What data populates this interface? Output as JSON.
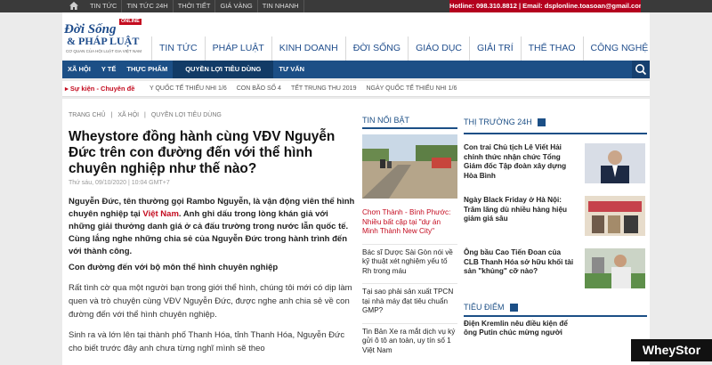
{
  "topbar": {
    "nav": [
      "TIN TỨC",
      "TIN TỨC 24H",
      "THỜI TIẾT",
      "GIÁ VÀNG",
      "TIN NHANH"
    ],
    "hotline": "Hotline: 098.310.8812 | Email: dsplonline.toasoan@gmail.com"
  },
  "logo": {
    "badge": "ONLINE",
    "line1": "Đời Sống",
    "line2": "& PHÁP LUẬT",
    "tagline": "CƠ QUAN CỦA HỘI LUẬT GIA VIỆT NAM"
  },
  "main_nav": [
    "TIN TỨC",
    "PHÁP LUẬT",
    "KINH DOANH",
    "ĐỜI SỐNG",
    "GIÁO DỤC",
    "GIẢI TRÍ",
    "THỂ THAO",
    "CÔNG NGHỆ"
  ],
  "sub_nav": [
    "XÃ HỘI",
    "Y TẾ",
    "THỰC PHẨM",
    "QUYỀN LỢI TIÊU DÙNG",
    "TƯ VẤN"
  ],
  "trending": {
    "lead": "Sự kiện - Chuyên đề",
    "items": [
      "Y QUỐC TẾ THIẾU NHI 1/6",
      "CON BÃO SỐ 4",
      "TẾT TRUNG THU 2019",
      "NGÀY QUỐC TẾ THIẾU NHI 1/6"
    ]
  },
  "article": {
    "breadcrumb": [
      "TRANG CHỦ",
      "|",
      "XÃ HỘI",
      "|",
      "QUYỀN LỢI TIÊU DÙNG"
    ],
    "title": "Wheystore đồng hành cùng VĐV Nguyễn Đức trên con đường đến với thể hình chuyên nghiệp như thế nào?",
    "meta": "Thứ sáu, 09/10/2020 | 10:04 GMT+7",
    "lead_before": "Nguyễn Đức, tên thường gọi Rambo Nguyễn, là vận động viên thể hình chuyên nghiệp tại ",
    "lead_link": "Việt Nam",
    "lead_after": ". Anh ghi dấu trong lòng khán giả với những giải thưởng danh giá ở cả đấu trường trong nước lẫn quốc tế. Cùng lắng nghe những chia sẻ của Nguyễn Đức trong hành trình đến với thành công.",
    "subheading": "Con đường đến với bộ môn thể hình chuyên nghiệp",
    "para1": "Rất tình cờ qua một người bạn trong giới thể hình, chúng tôi mới có dịp làm quen và trò chuyện cùng VĐV Nguyễn Đức, được nghe anh chia sẻ về con đường đến với thể hình chuyên nghiệp.",
    "para2": "Sinh ra và lớn lên tại thành phố Thanh Hóa, tỉnh Thanh Hóa, Nguyễn Đức cho biết trước đây anh chưa từng nghĩ mình sẽ theo"
  },
  "tin_noi_bat": {
    "heading": "TIN NỔI BẬT",
    "items": [
      "Chơn Thành - Bình Phước: Nhiều bất cập tại \"dự án Minh Thành New City\"",
      "Bác sĩ Dược Sài Gòn nói về kỹ thuật xét nghiệm yếu tố Rh trong máu",
      "Tại sao phải sản xuất TPCN tại nhà máy đạt tiêu chuẩn GMP?",
      "Tin Bản Xe ra mắt dịch vụ ký gửi ô tô an toàn, uy tín số 1 Việt Nam"
    ]
  },
  "thi_truong": {
    "heading": "THỊ TRƯỜNG 24H",
    "items": [
      "Con trai Chủ tịch Lê Viết Hải chính thức nhận chức Tổng Giám đốc Tập đoàn xây dựng Hòa Bình",
      "Ngày Black Friday ở Hà Nội: Trăm lăng dù nhiều hàng hiệu giảm giá sâu",
      "Ông bầu Cao Tiến Đoan của CLB Thanh Hóa sở hữu khối tài sản \"khủng\" cỡ nào?"
    ]
  },
  "tieu_diem": {
    "heading": "TIÊU ĐIỂM",
    "first": "Điện Kremlin nêu điều kiện để ông Putin chúc mừng người"
  },
  "watermark": "WheyStor",
  "colors": {
    "brand_blue": "#1c4f86",
    "accent_red": "#c40c20",
    "topbar": "#3a3a3a"
  }
}
